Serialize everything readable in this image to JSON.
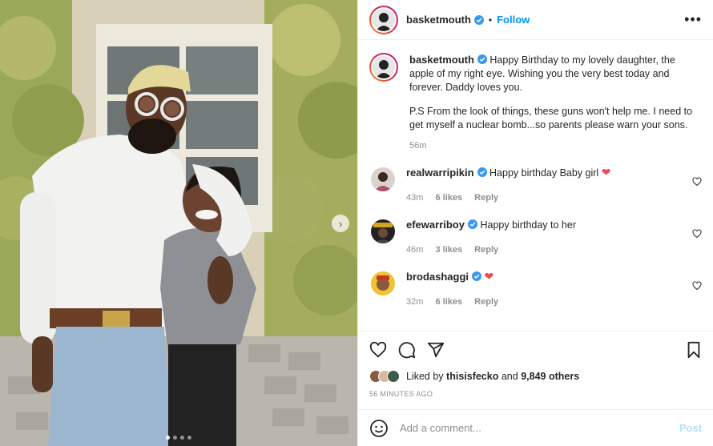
{
  "post": {
    "images_count": 4,
    "active_image_index": 0
  },
  "header": {
    "username": "basketmouth",
    "separator": "•",
    "follow_label": "Follow",
    "more_label": "•••"
  },
  "caption": {
    "username": "basketmouth",
    "text_1": "Happy Birthday to my lovely daughter, the apple of my right eye. Wishing you the very best today and forever. Daddy loves you.",
    "text_2": "P.S From the look of things, these guns won't help me. I need to get myself a nuclear bomb...so parents please warn your sons.",
    "time": "56m"
  },
  "comments": [
    {
      "username": "realwarripikin",
      "text": "Happy birthday Baby girl",
      "heart_emoji": true,
      "time": "43m",
      "likes": "6 likes",
      "reply": "Reply"
    },
    {
      "username": "efewarriboy",
      "text": "Happy birthday to her",
      "heart_emoji": false,
      "time": "46m",
      "likes": "3 likes",
      "reply": "Reply"
    },
    {
      "username": "brodashaggi",
      "text": "",
      "heart_emoji": true,
      "time": "32m",
      "likes": "6 likes",
      "reply": "Reply"
    }
  ],
  "likes": {
    "prefix": "Liked by ",
    "user": "thisisfecko",
    "middle": " and ",
    "others": "9,849 others"
  },
  "post_time": "56 MINUTES AGO",
  "comment_input": {
    "placeholder": "Add a comment...",
    "post_label": "Post"
  },
  "colors": {
    "accent": "#0095f6",
    "verified": "#3897f0",
    "heart": "#ed4956",
    "muted": "#8e8e8e"
  },
  "icons": [
    "heart-icon",
    "comment-icon",
    "share-icon",
    "bookmark-icon",
    "emoji-icon",
    "verified-badge-icon",
    "more-icon",
    "chevron-right-icon"
  ]
}
